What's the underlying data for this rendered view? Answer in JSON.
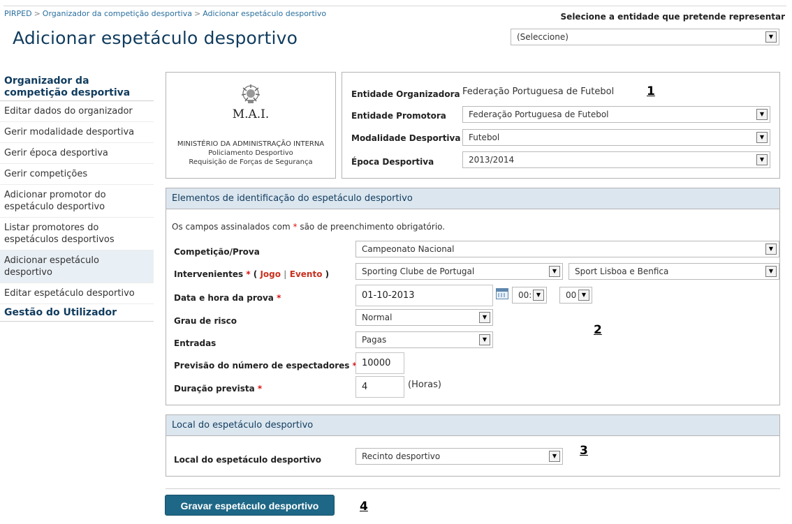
{
  "breadcrumb": [
    "PIRPED",
    "Organizador da competição desportiva",
    "Adicionar espetáculo desportivo"
  ],
  "page_title": "Adicionar espetáculo desportivo",
  "entity_selector": {
    "label": "Selecione a entidade que pretende representar",
    "value": "(Seleccione)"
  },
  "sidebar": {
    "section1": "Organizador da competição desportiva",
    "items": [
      "Editar dados do organizador",
      "Gerir modalidade desportiva",
      "Gerir época desportiva",
      "Gerir competições",
      "Adicionar promotor do espetáculo desportivo",
      "Listar promotores do espetáculos desportivos",
      "Adicionar espetáculo desportivo",
      "Editar espetáculo desportivo"
    ],
    "section2": "Gestão do Utilizador"
  },
  "logo": {
    "acronym": "M.A.I.",
    "line1": "MINISTÉRIO DA ADMINISTRAÇÃO INTERNA",
    "line2": "Policiamento Desportivo",
    "line3": "Requisição de Forças de Segurança"
  },
  "header_fields": {
    "org_label": "Entidade Organizadora",
    "org_value": "Federação Portuguesa de Futebol",
    "promoter_label": "Entidade Promotora",
    "promoter_value": "Federação Portuguesa de Futebol",
    "sport_label": "Modalidade Desportiva",
    "sport_value": "Futebol",
    "season_label": "Época Desportiva",
    "season_value": "2013/2014"
  },
  "identification": {
    "title": "Elementos de identificação do espetáculo desportivo",
    "note_pre": "Os campos assinalados com",
    "note_post": "são de preenchimento obrigatório.",
    "competition_label": "Competição/Prova",
    "competition_value": "Campeonato Nacional",
    "participants_label": "Intervenientes",
    "jogo": "Jogo",
    "evento": "Evento",
    "team1": "Sporting Clube de Portugal",
    "team2": "Sport Lisboa e Benfica",
    "date_label": "Data e hora da prova",
    "date_value": "01-10-2013",
    "hour_value": "00:",
    "minute_value": "00",
    "risk_label": "Grau de risco",
    "risk_value": "Normal",
    "entries_label": "Entradas",
    "entries_value": "Pagas",
    "spectators_label": "Previsão do número de espectadores",
    "spectators_value": "10000",
    "duration_label": "Duração prevista",
    "duration_value": "4",
    "duration_unit": "(Horas)"
  },
  "location": {
    "title": "Local do espetáculo desportivo",
    "label": "Local do espetáculo desportivo",
    "value": "Recinto desportivo"
  },
  "save_button": "Gravar espetáculo desportivo",
  "markers": [
    "1",
    "2",
    "3",
    "4"
  ]
}
